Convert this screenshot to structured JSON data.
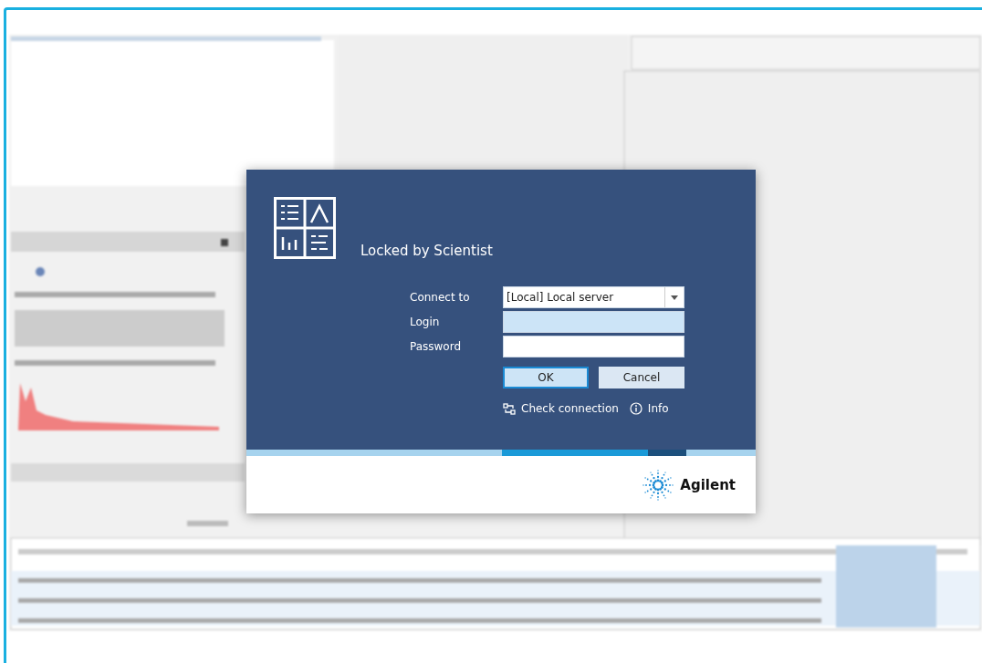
{
  "dialog": {
    "title": "Locked by Scientist",
    "fields": [
      {
        "label": "Connect to",
        "kind": "dropdown",
        "value": "[Local] Local server",
        "focused": false
      },
      {
        "label": "Login",
        "kind": "text",
        "focused": true
      },
      {
        "label": "Password",
        "kind": "password",
        "focused": false
      }
    ],
    "buttons": [
      {
        "label": "OK",
        "default": true
      },
      {
        "label": "Cancel",
        "default": false
      }
    ],
    "links": [
      {
        "label": "Check connection",
        "kind": "connection"
      },
      {
        "label": "Info",
        "kind": "info"
      }
    ],
    "brand": "Agilent"
  }
}
